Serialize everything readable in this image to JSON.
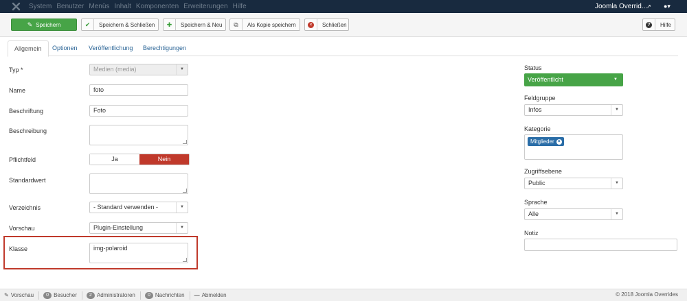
{
  "topbar": {
    "menu": [
      "System",
      "Benutzer",
      "Menüs",
      "Inhalt",
      "Komponenten",
      "Erweiterungen",
      "Hilfe"
    ],
    "site_name": "Joomla Overrid...",
    "icons": {
      "logo": "joomla-logo",
      "external": "external-link-icon",
      "user": "user-icon"
    }
  },
  "toolbar": {
    "save": "Speichern",
    "save_close": "Speichern & Schließen",
    "save_new": "Speichern & Neu",
    "save_copy": "Als Kopie speichern",
    "close": "Schließen",
    "help": "Hilfe"
  },
  "tabs": [
    "Allgemein",
    "Optionen",
    "Veröffentlichung",
    "Berechtigungen"
  ],
  "form": {
    "type_label": "Typ *",
    "type_value": "Medien (media)",
    "name_label": "Name",
    "name_value": "foto",
    "caption_label": "Beschriftung",
    "caption_value": "Foto",
    "description_label": "Beschreibung",
    "description_value": "",
    "required_label": "Pflichtfeld",
    "required_yes": "Ja",
    "required_no": "Nein",
    "default_label": "Standardwert",
    "default_value": "",
    "directory_label": "Verzeichnis",
    "directory_value": "- Standard verwenden -",
    "preview_label": "Vorschau",
    "preview_value": "Plugin-Einstellung",
    "class_label": "Klasse",
    "class_value": "img-polaroid"
  },
  "sidebar": {
    "status_label": "Status",
    "status_value": "Veröffentlicht",
    "group_label": "Feldgruppe",
    "group_value": "Infos",
    "category_label": "Kategorie",
    "category_chip": "Mitglieder",
    "access_label": "Zugriffsebene",
    "access_value": "Public",
    "language_label": "Sprache",
    "language_value": "Alle",
    "note_label": "Notiz",
    "note_value": ""
  },
  "footer": {
    "preview": "Vorschau",
    "visitors_count": "0",
    "visitors": "Besucher",
    "admins_count": "2",
    "admins": "Administratoren",
    "messages_count": "0",
    "messages": "Nachrichten",
    "logout": "Abmelden",
    "copyright": "© 2018 Joomla Overrides"
  },
  "colors": {
    "navbar": "#182a3f",
    "success": "#47a447",
    "danger": "#c0392b",
    "link": "#2a6496",
    "chip": "#2a6da7"
  }
}
